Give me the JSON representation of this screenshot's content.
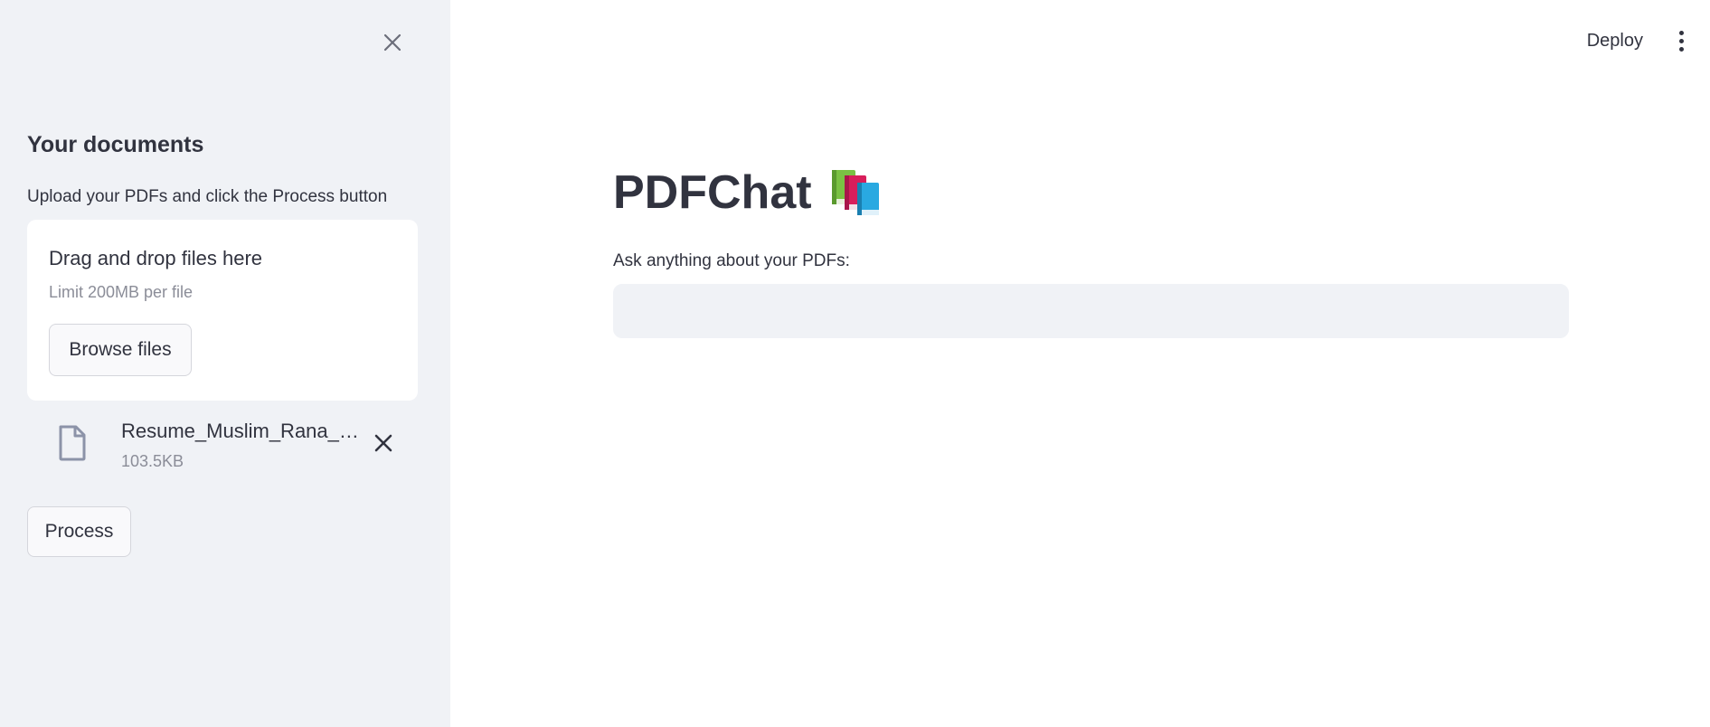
{
  "sidebar": {
    "close_icon": "close-icon",
    "title": "Your documents",
    "caption": "Upload your PDFs and click the Process button",
    "uploader": {
      "title": "Drag and drop files here",
      "limit": "Limit 200MB per file",
      "browse_label": "Browse files"
    },
    "files": [
      {
        "icon": "file-icon",
        "name": "Resume_Muslim_Rana_…",
        "size": "103.5KB",
        "remove_icon": "close-icon"
      }
    ],
    "process_label": "Process"
  },
  "header": {
    "deploy_label": "Deploy",
    "menu_icon": "more-vertical-icon"
  },
  "main": {
    "title": "PDFChat",
    "title_icon": "books-icon",
    "question_label": "Ask anything about your PDFs:",
    "question_value": "",
    "question_placeholder": ""
  },
  "colors": {
    "sidebar_bg": "#f0f2f6",
    "text": "#31333f",
    "muted": "#8b8d98",
    "input_bg": "#f0f2f6"
  }
}
